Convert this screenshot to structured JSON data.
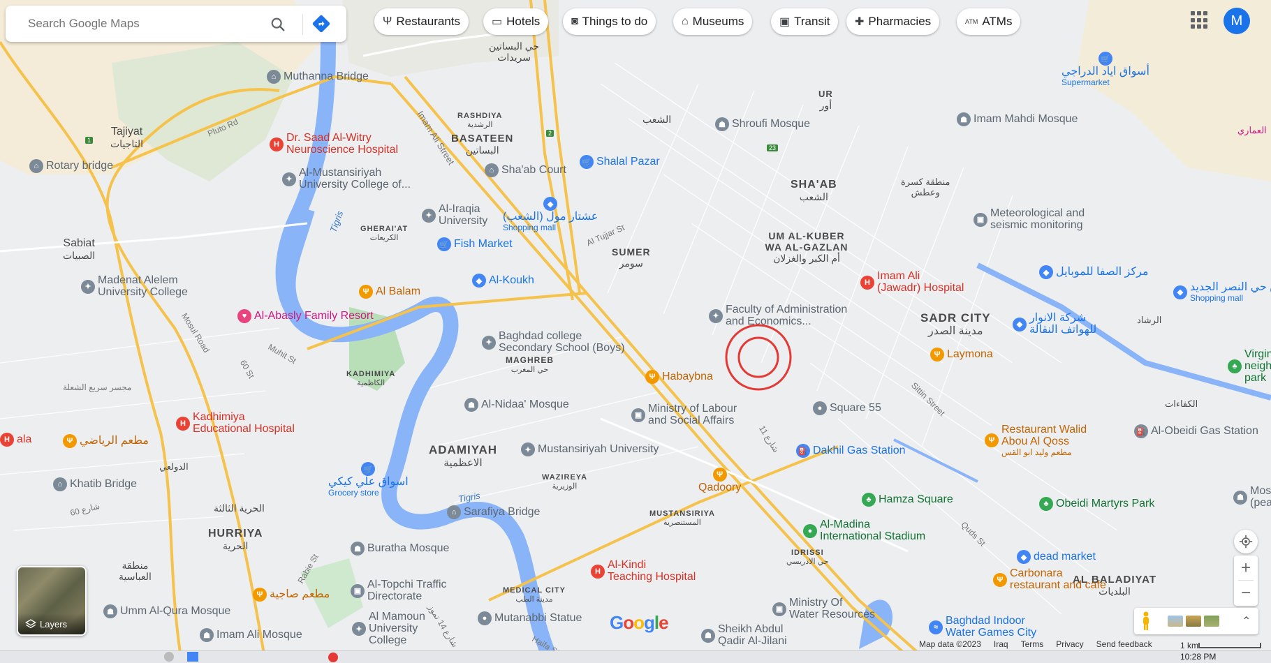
{
  "search": {
    "placeholder": "Search Google Maps"
  },
  "chips": [
    {
      "label": "Restaurants",
      "icon": "fork-knife-icon"
    },
    {
      "label": "Hotels",
      "icon": "bed-icon"
    },
    {
      "label": "Things to do",
      "icon": "camera-icon"
    },
    {
      "label": "Museums",
      "icon": "museum-icon"
    },
    {
      "label": "Transit",
      "icon": "train-icon"
    },
    {
      "label": "Pharmacies",
      "icon": "pharmacy-icon"
    },
    {
      "label": "ATMs",
      "icon": "atm-icon"
    }
  ],
  "account": {
    "initial": "M"
  },
  "areas": {
    "basateen": {
      "en": "BASATEEN",
      "ar": "البساتين"
    },
    "rashdiya": {
      "en": "RASHDIYA",
      "ar": "الرشدية"
    },
    "ur": {
      "en": "UR",
      "ar": "أور"
    },
    "shaab": {
      "en": "SHA'AB",
      "ar": "الشعب"
    },
    "umalkuber": {
      "en": "UM AL-KUBER WA AL-GAZLAN",
      "ar": "أم الكبر والغزلان"
    },
    "sumer": {
      "en": "SUMER",
      "ar": "سومر"
    },
    "sadr": {
      "en": "SADR CITY",
      "ar": "مدينة الصدر"
    },
    "ghera": {
      "en": "GHERAI'AT",
      "ar": "الكريعات"
    },
    "kadhimiya": {
      "en": "KADHIMIYA",
      "ar": "الكاظمية"
    },
    "maghreb": {
      "en": "MAGHREB",
      "ar": "حي المغرب"
    },
    "adamiyah": {
      "en": "ADAMIYAH",
      "ar": "الاعظمية"
    },
    "wazireya": {
      "en": "WAZIREYA",
      "ar": "الوزيرية"
    },
    "mustansiriya": {
      "en": "MUSTANSIRIYA",
      "ar": "المستنصرية"
    },
    "hurriya": {
      "en": "HURRIYA",
      "ar": "الحرية"
    },
    "idrissi": {
      "en": "IDRISSI",
      "ar": "حي الادريسي"
    },
    "baladiyat": {
      "en": "AL BALADIYAT",
      "ar": "البلديات"
    },
    "medical": {
      "en": "MEDICAL CITY",
      "ar": "مدينة الطب"
    },
    "tajiyat": {
      "en": "Tajiyat",
      "ar": "التاجيات"
    },
    "sabiat": {
      "en": "Sabiat",
      "ar": "الصبيات"
    },
    "hay_bsateen": {
      "en": "حي البساتين",
      "ar": "سريدات"
    },
    "shaab_ar": {
      "en": "الشعب",
      "ar": ""
    },
    "hurriya3": {
      "en": "الحرية الثالثة",
      "ar": ""
    },
    "abbasiya": {
      "en": "منطقة",
      "ar": "العباسية"
    },
    "dawoodi": {
      "en": "الدولعي",
      "ar": ""
    },
    "kasra": {
      "en": "منطقة كسرة",
      "ar": "وعطش"
    },
    "rashad": {
      "en": "الرشاد",
      "ar": ""
    },
    "kafaat": {
      "en": "الكفاءات",
      "ar": ""
    },
    "amari": {
      "en": "العماري",
      "ar": ""
    }
  },
  "pois": [
    {
      "key": "muthanna",
      "label": "Muthanna Bridge",
      "kind": "gray",
      "icon": "bridge-icon"
    },
    {
      "key": "rotary",
      "label": "Rotary bridge",
      "kind": "gray",
      "icon": "bridge-icon"
    },
    {
      "key": "saad",
      "label": "Dr. Saad Al-Witry\nNeuroscience Hospital",
      "kind": "red",
      "icon": "hospital-icon"
    },
    {
      "key": "mustansiriyah_uc",
      "label": "Al-Mustansiriyah\nUniversity College of...",
      "kind": "gray",
      "icon": "school-icon"
    },
    {
      "key": "iraqia",
      "label": "Al-Iraqia\nUniversity",
      "kind": "gray",
      "icon": "school-icon"
    },
    {
      "key": "shaab_court",
      "label": "Sha'ab Court",
      "kind": "gray",
      "icon": "court-icon"
    },
    {
      "key": "shalal",
      "label": "Shalal Pazar",
      "kind": "blue",
      "icon": "shopping-cart-icon"
    },
    {
      "key": "ashtar",
      "label": "عشتار مول (الشعب)",
      "sub": "Shopping mall",
      "kind": "blue",
      "icon": "shopping-bag-icon"
    },
    {
      "key": "fish",
      "label": "Fish Market",
      "kind": "blue",
      "icon": "shopping-cart-icon"
    },
    {
      "key": "koukh",
      "label": "Al-Koukh",
      "kind": "blue",
      "icon": "shopping-bag-icon"
    },
    {
      "key": "madenat",
      "label": "Madenat Alelem\nUniversity College",
      "kind": "gray",
      "icon": "school-icon"
    },
    {
      "key": "balam",
      "label": "Al Balam",
      "kind": "orange",
      "icon": "fork-knife-icon"
    },
    {
      "key": "abasly",
      "label": "Al-Abasly Family Resort",
      "kind": "pink",
      "icon": "hotel-icon"
    },
    {
      "key": "baghdad_college",
      "label": "Baghdad college\nSecondary School (Boys)",
      "kind": "gray",
      "icon": "school-icon"
    },
    {
      "key": "shroufi",
      "label": "Shroufi Mosque",
      "kind": "gray",
      "icon": "mosque-icon"
    },
    {
      "key": "imam_mahdi",
      "label": "Imam Mahdi Mosque",
      "kind": "gray",
      "icon": "mosque-icon"
    },
    {
      "key": "aswaq_ayad",
      "label": "أسواق اياد الدراجي",
      "sub": "Supermarket",
      "kind": "blue",
      "icon": "shopping-cart-icon"
    },
    {
      "key": "meteo",
      "label": "Meteorological and\nseismic monitoring",
      "kind": "gray",
      "icon": "office-icon"
    },
    {
      "key": "safa",
      "label": "مركز الصفا للموبايل",
      "kind": "blue",
      "icon": "shopping-bag-icon"
    },
    {
      "key": "imam_ali",
      "label": "Imam Ali\n(Jawadr) Hospital",
      "kind": "red",
      "icon": "hospital-icon"
    },
    {
      "key": "faculty",
      "label": "Faculty of Administration\nand Economics...",
      "kind": "gray",
      "icon": "school-icon"
    },
    {
      "key": "anwar",
      "label": "شركة الانوار\nللهواتف النقالة",
      "kind": "blue",
      "icon": "shopping-bag-icon"
    },
    {
      "key": "laymona",
      "label": "Laymona",
      "kind": "orange",
      "icon": "fork-knife-icon"
    },
    {
      "key": "habaybna",
      "label": "Habaybna",
      "kind": "orange",
      "icon": "fork-knife-icon"
    },
    {
      "key": "kadhimiya_hosp",
      "label": "Kadhimiya\nEducational Hospital",
      "kind": "red",
      "icon": "hospital-icon"
    },
    {
      "key": "nidaa",
      "label": "Al-Nidaa' Mosque",
      "kind": "gray",
      "icon": "mosque-icon"
    },
    {
      "key": "labour",
      "label": "Ministry of Labour\nand Social Affairs",
      "kind": "gray",
      "icon": "office-icon"
    },
    {
      "key": "square55",
      "label": "Square 55",
      "kind": "gray",
      "icon": "pin-icon"
    },
    {
      "key": "walid",
      "label": "Restaurant Walid\nAbou Al Qoss",
      "sub": "مطعم وليد ابو القس",
      "kind": "orange",
      "icon": "fork-knife-icon"
    },
    {
      "key": "obeidi_gas",
      "label": "Al-Obeidi Gas Station",
      "kind": "gray",
      "icon": "gas-icon"
    },
    {
      "key": "mat3am_riyadi",
      "label": "مطعم الرياضي",
      "kind": "orange",
      "icon": "fork-knife-icon"
    },
    {
      "key": "mustansiriyah_univ",
      "label": "Mustansiriyah University",
      "kind": "gray",
      "icon": "school-icon"
    },
    {
      "key": "dakhil",
      "label": "Dakhil Gas Station",
      "kind": "blue",
      "icon": "gas-icon"
    },
    {
      "key": "aswaq_ali",
      "label": "اسواق علي كيكي",
      "sub": "Grocery store",
      "kind": "blue",
      "icon": "shopping-cart-icon"
    },
    {
      "key": "khatib",
      "label": "Khatib Bridge",
      "kind": "gray",
      "icon": "bridge-icon"
    },
    {
      "key": "qadoory",
      "label": "Qadoory",
      "kind": "orange",
      "icon": "fork-knife-icon"
    },
    {
      "key": "hamza",
      "label": "Hamza Square",
      "kind": "green",
      "icon": "tree-icon"
    },
    {
      "key": "obeidi_park",
      "label": "Obeidi Martyrs Park",
      "kind": "green",
      "icon": "tree-icon"
    },
    {
      "key": "sarafiya",
      "label": "Sarafiya Bridge",
      "kind": "gray",
      "icon": "bridge-icon"
    },
    {
      "key": "madina",
      "label": "Al-Madina\nInternational Stadium",
      "kind": "green",
      "icon": "stadium-icon"
    },
    {
      "key": "buratha",
      "label": "Buratha Mosque",
      "kind": "gray",
      "icon": "mosque-icon"
    },
    {
      "key": "dead_market",
      "label": "dead market",
      "kind": "blue",
      "icon": "shopping-bag-icon"
    },
    {
      "key": "topchi",
      "label": "Al-Topchi Traffic\nDirectorate",
      "kind": "gray",
      "icon": "office-icon"
    },
    {
      "key": "sajiya",
      "label": "مطعم صاجية",
      "kind": "orange",
      "icon": "fork-knife-icon"
    },
    {
      "key": "kindi",
      "label": "Al-Kindi\nTeaching Hospital",
      "kind": "red",
      "icon": "hospital-icon"
    },
    {
      "key": "carbonara",
      "label": "Carbonara\nrestaurant and cafe",
      "kind": "orange",
      "icon": "fork-knife-icon"
    },
    {
      "key": "umm_qura",
      "label": "Umm Al-Qura Mosque",
      "kind": "gray",
      "icon": "mosque-icon"
    },
    {
      "key": "mamoun",
      "label": "Al Mamoun\nUniversity\nCollege",
      "kind": "gray",
      "icon": "school-icon"
    },
    {
      "key": "water_res",
      "label": "Ministry Of\nWater Resources",
      "kind": "gray",
      "icon": "office-icon"
    },
    {
      "key": "mutanabbi",
      "label": "Mutanabbi Statue",
      "kind": "gray",
      "icon": "pin-icon"
    },
    {
      "key": "imam_ali_mosque",
      "label": "Imam Ali Mosque",
      "kind": "gray",
      "icon": "mosque-icon"
    },
    {
      "key": "sheikh",
      "label": "Sheikh Abdul\nQadir Al-Jilani",
      "kind": "gray",
      "icon": "mosque-icon"
    },
    {
      "key": "water_games",
      "label": "Baghdad Indoor\nWater Games City",
      "kind": "blue",
      "icon": "water-park-icon"
    },
    {
      "key": "virgin",
      "label": "Virgin\nneighbor\npark",
      "kind": "green",
      "icon": "tree-icon"
    },
    {
      "key": "souk_nasr",
      "label": "سوق حي النصر الجديد",
      "sub": "Shopping mall",
      "kind": "blue",
      "icon": "shopping-bag-icon"
    },
    {
      "key": "mosq_peace",
      "label": "Mosq\n(peac",
      "kind": "gray",
      "icon": "mosque-icon"
    },
    {
      "key": "ala_hosp",
      "label": "ala",
      "kind": "red",
      "icon": "hospital-icon"
    }
  ],
  "streets": {
    "pluto": "Pluto Rd",
    "imam_ali_st": "Imam Ali Street",
    "tujjar": "Al Tujjar St",
    "mosul": "Mosul Road",
    "muhit": "Muhit St",
    "st60": "60 St",
    "sittin": "Sittin Street",
    "quds": "Quds St",
    "rabie": "Rabie St",
    "haifa": "Haifa St",
    "rd60": "60 شارع",
    "majsar": "مجسر سريع الشعلة",
    "st11": "شارع 11",
    "st14": "شارع 14 تموز",
    "tigris1": "Tigris",
    "tigris2": "Tigris"
  },
  "route_shields": [
    "1",
    "2",
    "23"
  ],
  "footer": {
    "map_data": "Map data ©2023",
    "country": "Iraq",
    "terms": "Terms",
    "privacy": "Privacy",
    "feedback": "Send feedback",
    "scale": "1 km",
    "clock": "10:28 PM"
  },
  "layers": {
    "label": "Layers"
  },
  "logo": {
    "text": "Google"
  },
  "colors": {
    "target": "#e53935",
    "road": "#f5c24c",
    "water": "#8ab4f8",
    "park": "#c8e6c9"
  }
}
